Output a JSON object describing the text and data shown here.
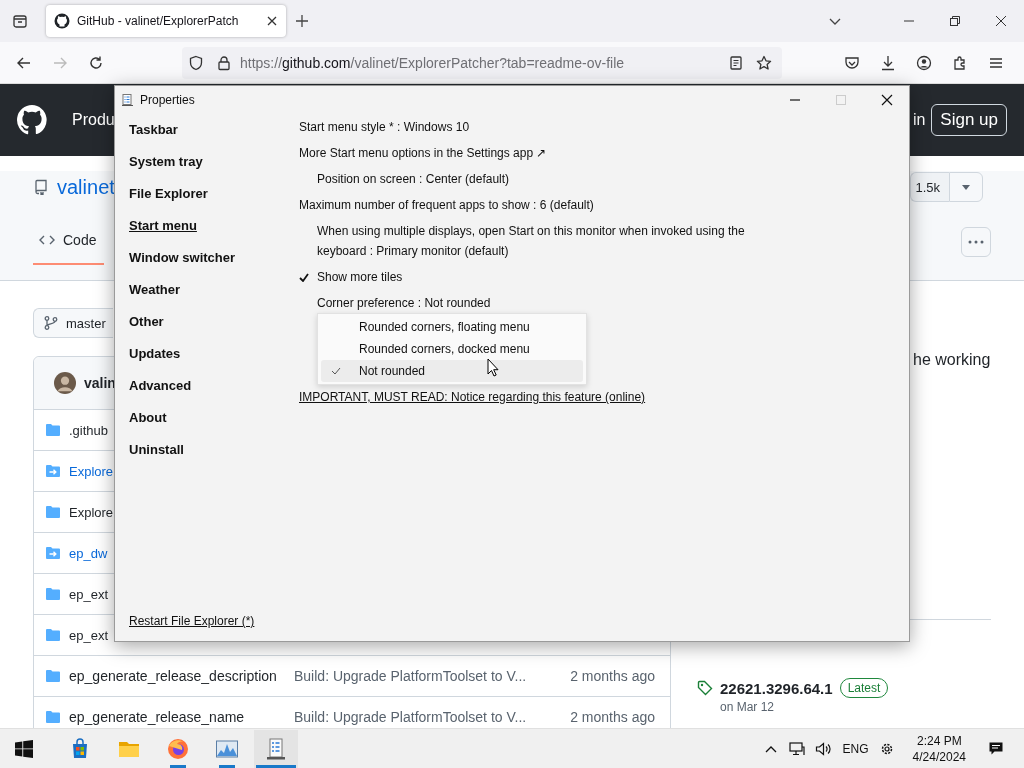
{
  "browser": {
    "tab": {
      "title": "GitHub - valinet/ExplorerPatch",
      "selected": true
    },
    "address": {
      "scheme": "https://",
      "host": "github.com",
      "rest": "/valinet/ExplorerPatcher?tab=readme-ov-file"
    }
  },
  "github": {
    "header": {
      "nav_item": "Produ",
      "sign_in": "in",
      "sign_up": "Sign up"
    },
    "repo": {
      "owner": "valinet",
      "star_count": "1.5k"
    },
    "tabs": [
      {
        "label": "Code",
        "selected": true
      }
    ],
    "branch": "master",
    "commit_author": "valin",
    "files": [
      {
        "name": ".github",
        "kind": "folder"
      },
      {
        "name": "Explore",
        "kind": "submodule"
      },
      {
        "name": "Explore",
        "kind": "folder"
      },
      {
        "name": "ep_dw",
        "kind": "submodule"
      },
      {
        "name": "ep_ext",
        "kind": "folder"
      },
      {
        "name": "ep_ext",
        "kind": "folder"
      },
      {
        "name": "ep_generate_release_description",
        "kind": "folder",
        "message": "Build: Upgrade PlatformToolset to V...",
        "time": "2 months ago"
      },
      {
        "name": "ep_generate_release_name",
        "kind": "folder",
        "message": "Build: Upgrade PlatformToolset to V...",
        "time": "2 months ago"
      }
    ],
    "about_fragment": "he working",
    "release": {
      "tag": "22621.3296.64.1",
      "badge": "Latest",
      "date": "on Mar 12"
    }
  },
  "window": {
    "title": "Properties",
    "sidebar": [
      {
        "label": "Taskbar",
        "selected": false
      },
      {
        "label": "System tray",
        "selected": false
      },
      {
        "label": "File Explorer",
        "selected": false
      },
      {
        "label": "Start menu",
        "selected": true
      },
      {
        "label": "Window switcher",
        "selected": false
      },
      {
        "label": "Weather",
        "selected": false
      },
      {
        "label": "Other",
        "selected": false
      },
      {
        "label": "Updates",
        "selected": false
      },
      {
        "label": "Advanced",
        "selected": false
      },
      {
        "label": "About",
        "selected": false
      },
      {
        "label": "Uninstall",
        "selected": false
      }
    ],
    "restart_link": "Restart File Explorer (*)",
    "options": [
      {
        "kind": "setting",
        "label": "Start menu style * : Windows 10",
        "indented": false
      },
      {
        "kind": "link",
        "label": "More Start menu options in the Settings app ↗",
        "indented": false
      },
      {
        "kind": "setting",
        "label": "Position on screen : Center (default)",
        "indented": true
      },
      {
        "kind": "setting",
        "label": "Maximum number of frequent apps to show : 6 (default)",
        "indented": false
      },
      {
        "kind": "setting",
        "label": "When using multiple displays, open Start on this monitor when invoked using the keyboard : Primary monitor (default)",
        "indented": true
      },
      {
        "kind": "check",
        "label": "Show more tiles",
        "checked": true
      },
      {
        "kind": "setting",
        "label": "Corner preference : Not rounded",
        "indented": true,
        "menu": [
          {
            "label": "Rounded corners, floating menu",
            "selected": false,
            "hovered": false
          },
          {
            "label": "Rounded corners, docked menu",
            "selected": false,
            "hovered": false
          },
          {
            "label": "Not rounded",
            "selected": true,
            "hovered": true
          }
        ]
      },
      {
        "kind": "notice",
        "label": "IMPORTANT, MUST READ: Notice regarding this feature (online)",
        "indented": false
      }
    ]
  },
  "taskbar": {
    "apps": [
      {
        "kind": "store",
        "running": false,
        "selected": false
      },
      {
        "kind": "folder",
        "running": false,
        "selected": false
      },
      {
        "kind": "firefox",
        "running": true,
        "selected": false
      },
      {
        "kind": "monitor",
        "running": true,
        "selected": false
      },
      {
        "kind": "properties",
        "running": true,
        "selected": true
      }
    ],
    "language": "ENG",
    "time": "2:24 PM",
    "date": "4/24/2024"
  }
}
